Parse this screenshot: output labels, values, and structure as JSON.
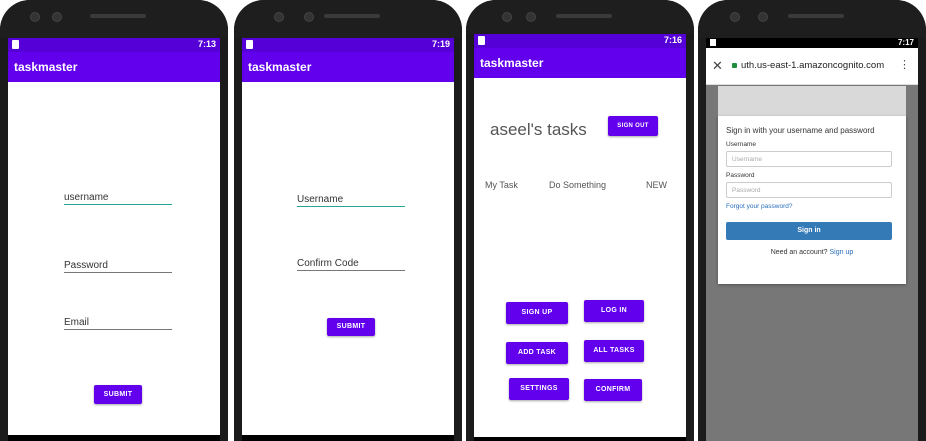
{
  "phones": {
    "p1": {
      "status_time": "7:13",
      "app_title": "taskmaster",
      "username_field": "username",
      "password_field": "Password",
      "email_field": "Email",
      "submit": "SUBMIT"
    },
    "p2": {
      "status_time": "7:19",
      "app_title": "taskmaster",
      "username_field": "Username",
      "confirm_code_field": "Confirm Code",
      "submit": "SUBMIT"
    },
    "p3": {
      "status_time": "7:16",
      "app_title": "taskmaster",
      "heading": "aseel's tasks",
      "sign_out": "SIGN OUT",
      "task": {
        "title": "My Task",
        "body": "Do Something",
        "state": "NEW"
      },
      "buttons": [
        "SIGN UP",
        "LOG IN",
        "ADD TASK",
        "ALL TASKS",
        "SETTINGS",
        "CONFIRM"
      ]
    },
    "p4": {
      "status_time": "7:17",
      "url": "uth.us-east-1.amazoncognito.com",
      "close_icon": "close-icon",
      "lock_icon": "lock-icon",
      "menu_icon": "kebab-menu-icon",
      "signin_heading": "Sign in with your username and password",
      "username_label": "Username",
      "username_placeholder": "Username",
      "password_label": "Password",
      "password_placeholder": "Password",
      "forgot": "Forgot your password?",
      "signin_button": "Sign in",
      "need_account": "Need an account?",
      "signup_link": "Sign up"
    }
  },
  "colors": {
    "primary": "#6200ee",
    "status": "#5400d6",
    "cognito_blue": "#337ab7",
    "link": "#2a6ebb"
  }
}
